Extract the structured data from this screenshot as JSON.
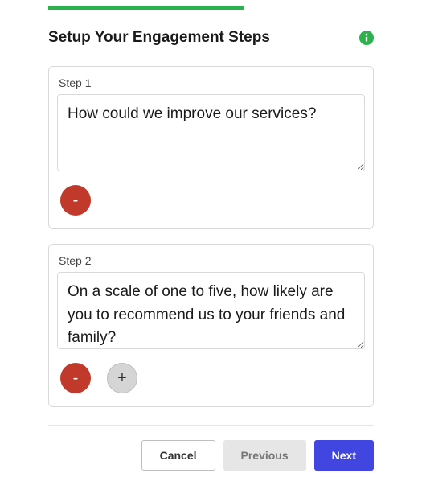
{
  "header": {
    "title": "Setup Your Engagement Steps"
  },
  "steps": [
    {
      "label": "Step 1",
      "value": "How could we improve our services?",
      "show_add": false
    },
    {
      "label": "Step 2",
      "value": "On a scale of one to five, how likely are you to recommend us to your friends and family?",
      "show_add": true
    }
  ],
  "buttons": {
    "remove": "-",
    "add": "+",
    "cancel": "Cancel",
    "previous": "Previous",
    "next": "Next"
  }
}
